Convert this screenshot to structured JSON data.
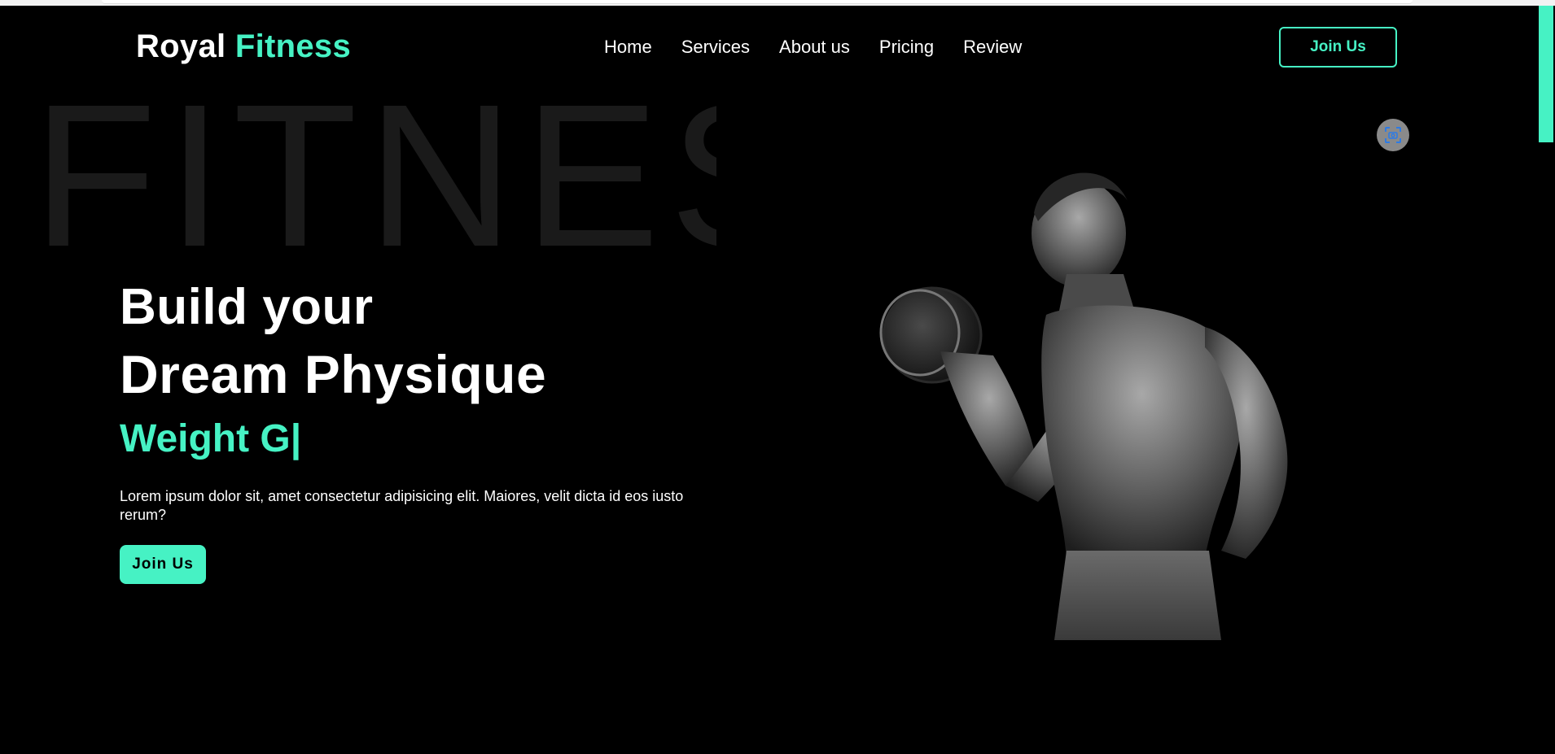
{
  "brand": {
    "name_part1": "Royal",
    "name_part2": "Fitness",
    "accent_color": "#46f2c4"
  },
  "nav": {
    "items": [
      {
        "label": "Home"
      },
      {
        "label": "Services"
      },
      {
        "label": "About us"
      },
      {
        "label": "Pricing"
      },
      {
        "label": "Review"
      }
    ],
    "cta_label": "Join Us"
  },
  "hero": {
    "background_word": "FITNESS",
    "title_line1": "Build your",
    "title_line2": "Dream Physique",
    "typed_text": "Weight G|",
    "description": "Lorem ipsum dolor sit, amet consectetur adipisicing elit. Maiores, velit dicta id eos iusto rerum?",
    "cta_label": "Join Us",
    "image_icon": "bodybuilder-with-dumbbell",
    "overlay_icon": "screenshot-capture-icon"
  },
  "colors": {
    "background": "#000000",
    "text": "#ffffff",
    "accent": "#46f2c4"
  }
}
